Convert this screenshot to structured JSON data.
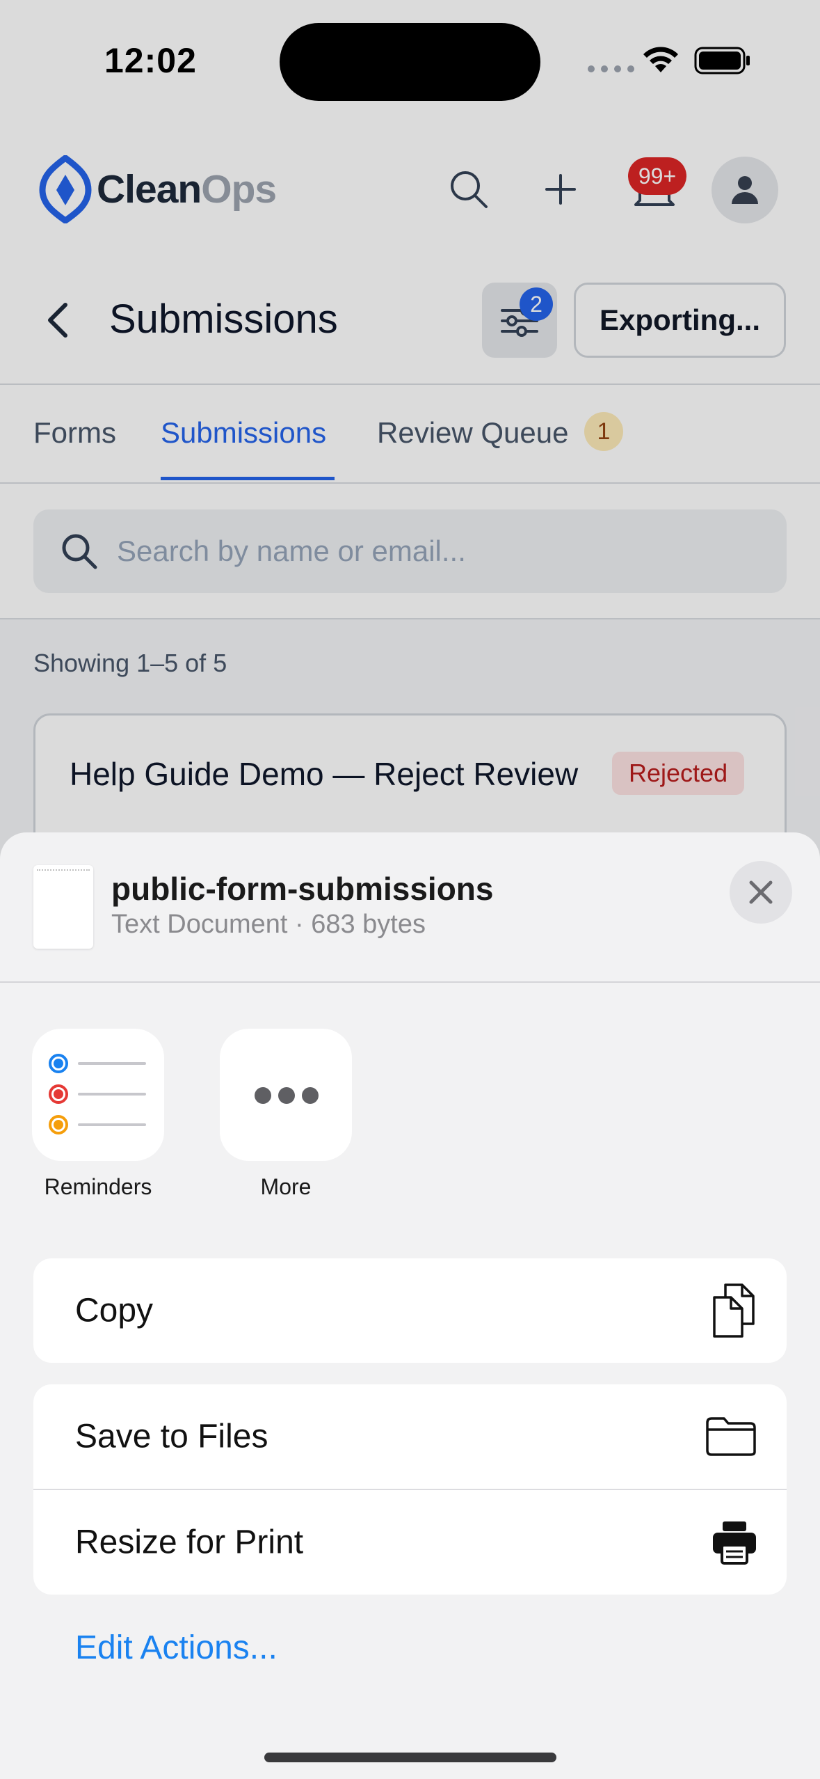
{
  "status_bar": {
    "time": "12:02"
  },
  "header": {
    "logo_clean": "Clean",
    "logo_ops": "Ops",
    "notifications_count": "99+"
  },
  "page": {
    "title": "Submissions",
    "filter_count": "2",
    "export_label": "Exporting..."
  },
  "tabs": [
    {
      "label": "Forms",
      "active": false
    },
    {
      "label": "Submissions",
      "active": true
    },
    {
      "label": "Review Queue",
      "active": false,
      "badge": "1"
    }
  ],
  "search": {
    "placeholder": "Search by name or email..."
  },
  "list": {
    "showing": "Showing 1–5 of 5",
    "items": [
      {
        "title": "Help Guide Demo — Reject Review",
        "status": "Rejected"
      }
    ]
  },
  "share_sheet": {
    "file_name": "public-form-submissions",
    "file_meta": "Text Document · 683 bytes",
    "apps": [
      {
        "label": "Reminders",
        "icon": "reminders-icon"
      },
      {
        "label": "More",
        "icon": "more-icon"
      }
    ],
    "actions": [
      {
        "label": "Copy",
        "icon": "copy-icon"
      },
      {
        "label": "Save to Files",
        "icon": "folder-icon"
      },
      {
        "label": "Resize for Print",
        "icon": "printer-icon"
      }
    ],
    "edit_actions": "Edit Actions..."
  },
  "colors": {
    "brand_blue": "#2563eb",
    "danger": "#dc2626",
    "ios_link": "#1a82f0"
  }
}
